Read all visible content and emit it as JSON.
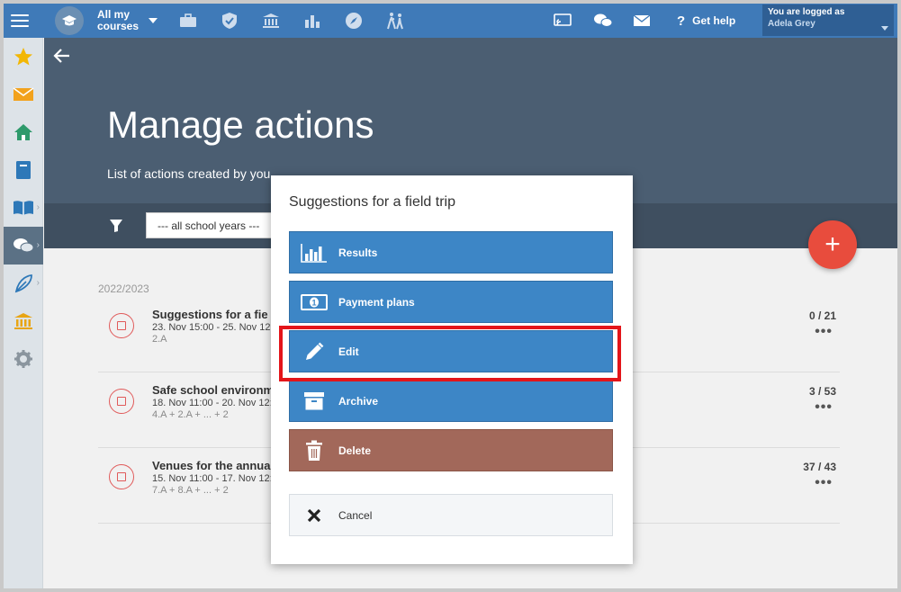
{
  "topbar": {
    "courses_label": "All my\ncourses",
    "help_label": "Get help",
    "login_label": "You are logged as",
    "user_name": "Adela Grey",
    "icons": [
      "briefcase-icon",
      "shield-icon",
      "institution-icon",
      "bar-chart-icon",
      "compass-icon",
      "hiking-icon"
    ]
  },
  "sidebar": {
    "items": [
      "star-icon",
      "envelope-icon",
      "home-icon",
      "notebook-icon",
      "book-icon",
      "chat-icon",
      "feather-icon",
      "institution-icon",
      "gear-icon"
    ]
  },
  "header": {
    "title": "Manage actions",
    "subtitle": "List of actions created by you",
    "year_select": "--- all school years ---"
  },
  "list": {
    "year": "2022/2023",
    "rows": [
      {
        "title": "Suggestions for a fie",
        "dates": "23. Nov 15:00 - 25. Nov 12:",
        "classes": "2.A",
        "count": "0 / 21"
      },
      {
        "title": "Safe school environm",
        "dates": "18. Nov 11:00 - 20. Nov 12:",
        "classes": "4.A + 2.A + ... + 2",
        "count": "3 / 53"
      },
      {
        "title": "Venues for the annua",
        "dates": "15. Nov 11:00 - 17. Nov 12:",
        "classes": "7.A + 8.A + ... + 2",
        "count": "37 / 43"
      }
    ]
  },
  "modal": {
    "title": "Suggestions for a field trip",
    "buttons": {
      "results": "Results",
      "payment_plans": "Payment plans",
      "edit": "Edit",
      "archive": "Archive",
      "delete": "Delete",
      "cancel": "Cancel"
    }
  },
  "colors": {
    "topbar": "#3f7ab8",
    "header": "#4b5e72",
    "primary_button": "#3d86c6",
    "delete_button": "#a2685a",
    "fab": "#e84c3d",
    "highlight": "#e3151a"
  }
}
